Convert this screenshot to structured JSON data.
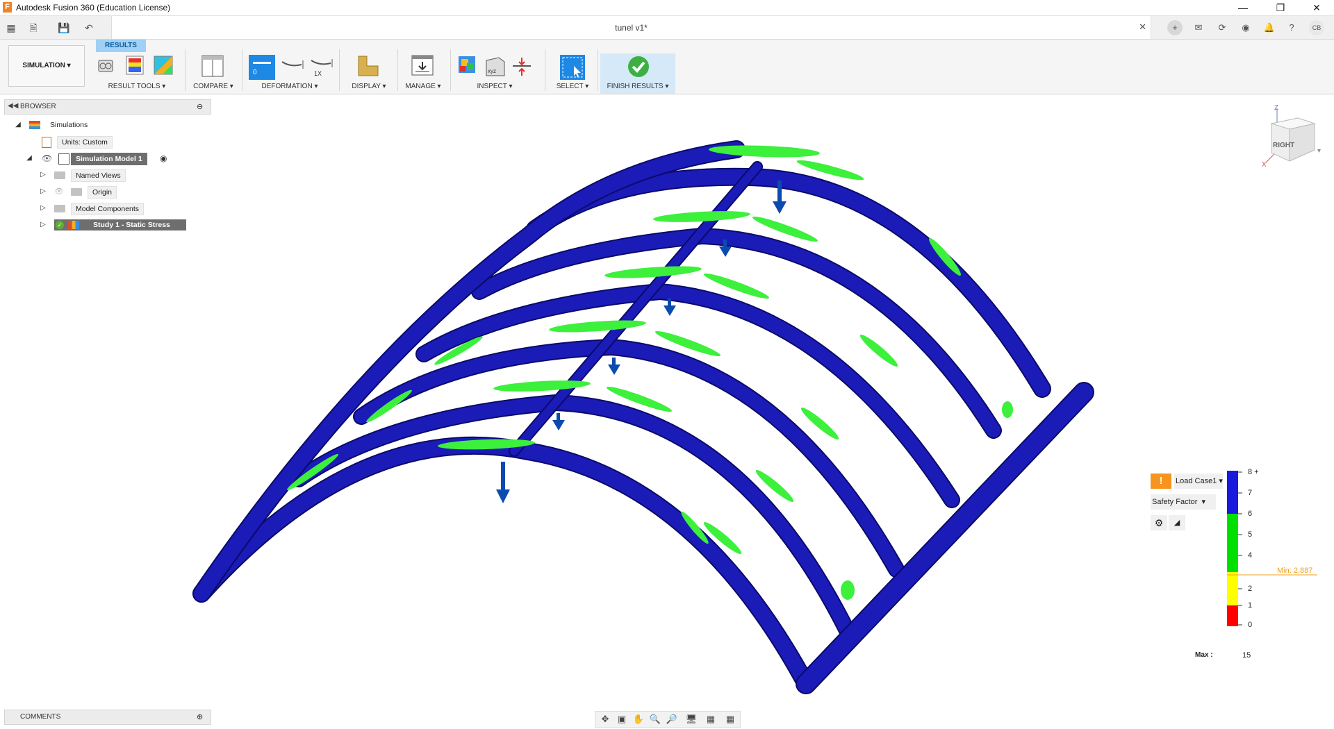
{
  "app": {
    "window_title": "Autodesk Fusion 360 (Education License)",
    "logo_letter": "F",
    "document_tab": "tunel v1*",
    "user_initials": "CB"
  },
  "ribbon": {
    "active_tab": "RESULTS",
    "workspace": "SIMULATION",
    "groups": [
      {
        "label": "RESULT TOOLS"
      },
      {
        "label": "COMPARE"
      },
      {
        "label": "DEFORMATION"
      },
      {
        "label": "DISPLAY"
      },
      {
        "label": "MANAGE"
      },
      {
        "label": "INSPECT"
      },
      {
        "label": "SELECT"
      },
      {
        "label": "FINISH RESULTS"
      }
    ],
    "deformation_value": "0",
    "deformation_scale": "1X"
  },
  "browser": {
    "title": "BROWSER",
    "items": [
      {
        "label": "Simulations"
      },
      {
        "label": "Units: Custom"
      },
      {
        "label": "Simulation Model 1"
      },
      {
        "label": "Named Views"
      },
      {
        "label": "Origin"
      },
      {
        "label": "Model Components"
      },
      {
        "label": "Study 1 - Static Stress"
      }
    ]
  },
  "comments": {
    "title": "COMMENTS"
  },
  "viewcube": {
    "face": "RIGHT",
    "axis_z": "Z",
    "axis_x": "X"
  },
  "legend": {
    "load_case": "Load Case1",
    "result_type": "Safety Factor",
    "ticks": [
      "8 +",
      "7",
      "6",
      "5",
      "4",
      "2",
      "1",
      "0"
    ],
    "min_label": "Min: 2.887",
    "max_label": "Max :",
    "max_value": "15",
    "colors": {
      "blue": "#1a1adf",
      "green": "#00e000",
      "yellow": "#ffff00",
      "red": "#ff0000",
      "min_line": "#f0a020"
    }
  },
  "model_colors": {
    "body": "#1b1bb8",
    "highlight": "#3cf03c",
    "load_arrow": "#0b4bb0"
  }
}
